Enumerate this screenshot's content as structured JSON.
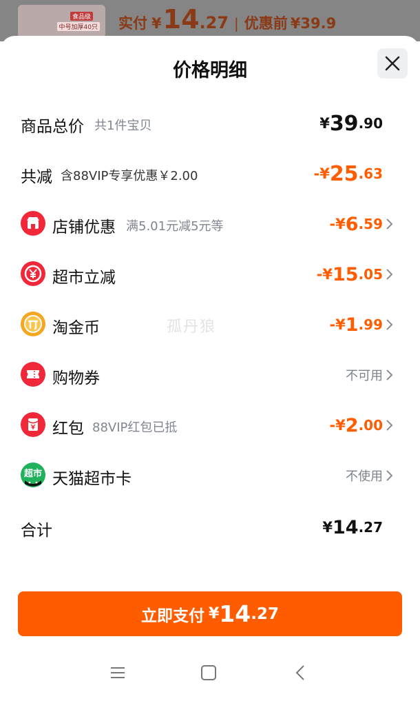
{
  "top": {
    "thumb_tag1": "食品级",
    "thumb_tag2": "中号加厚40只",
    "paid_label": "实付",
    "currency": "¥",
    "paid_int": "14",
    "paid_dec": ".27",
    "separator": "|",
    "original_label": "优惠前",
    "original_price": "¥39.9"
  },
  "sheet": {
    "title": "价格明细"
  },
  "rows": [
    {
      "label": "商品总价",
      "sub": "共1件宝贝",
      "sign": "",
      "yen": "¥",
      "int": "39",
      "dec": ".90"
    },
    {
      "label": "共减",
      "sub": "含88VIP专享优惠￥2.00",
      "sign": "-",
      "yen": "¥",
      "int": "25",
      "dec": ".63"
    },
    {
      "label": "店铺优惠",
      "sub": "满5.01元减5元等",
      "sign": "-",
      "yen": "¥",
      "int": "6",
      "dec": ".59",
      "icon": "shop-icon"
    },
    {
      "label": "超市立减",
      "sub": "",
      "sign": "-",
      "yen": "¥",
      "int": "15",
      "dec": ".05",
      "icon": "yuan-discount-icon"
    },
    {
      "label": "淘金币",
      "sub": "",
      "sign": "-",
      "yen": "¥",
      "int": "1",
      "dec": ".99",
      "icon": "coin-icon"
    },
    {
      "label": "购物券",
      "sub": "",
      "status": "不可用",
      "icon": "ticket-icon"
    },
    {
      "label": "红包",
      "sub": "88VIP红包已抵",
      "sign": "-",
      "yen": "¥",
      "int": "2",
      "dec": ".00",
      "icon": "red-packet-icon"
    },
    {
      "label": "天猫超市卡",
      "sub": "",
      "status": "不使用",
      "icon": "supermarket-card-icon",
      "icon_text": "超市"
    },
    {
      "label": "合计",
      "sub": "",
      "sign": "",
      "yen": "¥",
      "int": "14",
      "dec": ".27"
    }
  ],
  "watermark": "孤丹狼",
  "pay_button": {
    "label": "立即支付",
    "yen": "¥",
    "int": "14",
    "dec": ".27"
  },
  "colors": {
    "accent": "#ff5c00",
    "discount": "#ff5d00",
    "red_icon": "#f0283a",
    "coin": "#f5a623",
    "green": "#1fb15c"
  }
}
